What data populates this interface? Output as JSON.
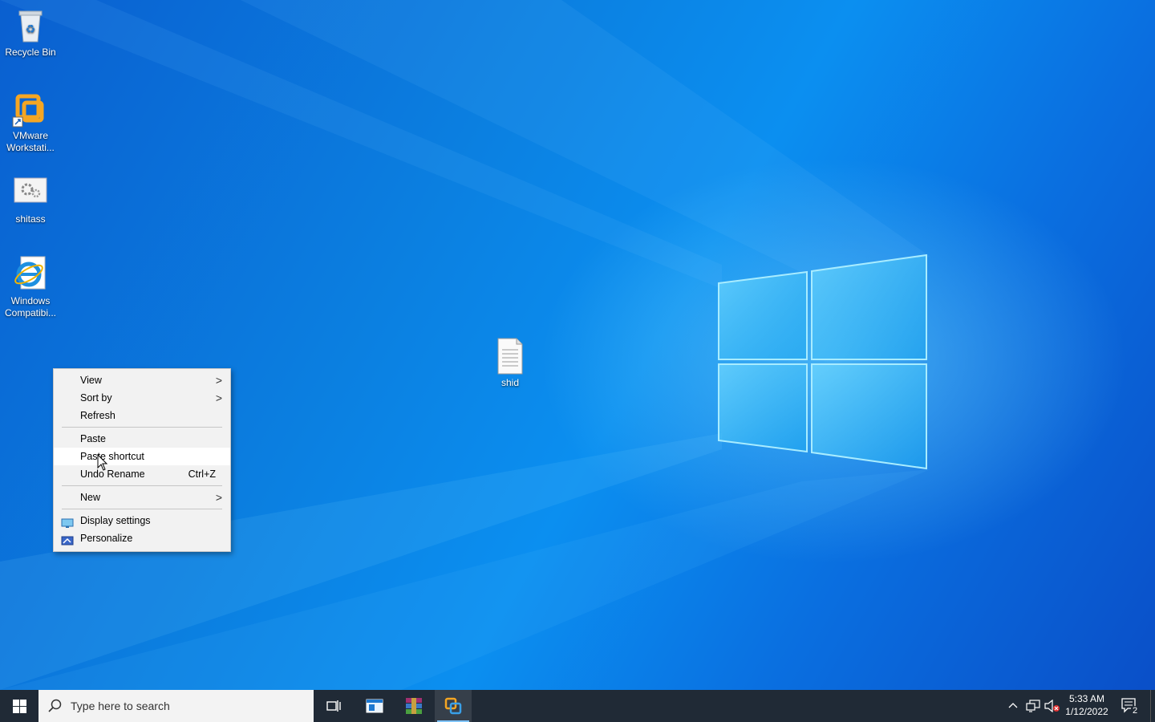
{
  "desktop_icons": {
    "recycle_bin": "Recycle Bin",
    "vmware": "VMware Workstati...",
    "shitass": "shitass",
    "windows_compat": "Windows Compatibi...",
    "shid": "shid"
  },
  "context_menu": {
    "view": "View",
    "sort_by": "Sort by",
    "refresh": "Refresh",
    "paste": "Paste",
    "paste_shortcut": "Paste shortcut",
    "undo_rename": "Undo Rename",
    "undo_shortcut": "Ctrl+Z",
    "new": "New",
    "display_settings": "Display settings",
    "personalize": "Personalize"
  },
  "taskbar": {
    "search_placeholder": "Type here to search",
    "time": "5:33 AM",
    "date": "1/12/2022",
    "notification_count": "2"
  },
  "icons": {
    "start": "windows-start-icon",
    "task_view": "task-view-icon",
    "file_explorer": "window-app-icon",
    "winrar": "winrar-icon",
    "vmware": "vmware-icon"
  },
  "colors": {
    "menu_bg": "#f2f2f2",
    "taskbar_bg": "#202a36",
    "accent": "#7fc4ff"
  }
}
